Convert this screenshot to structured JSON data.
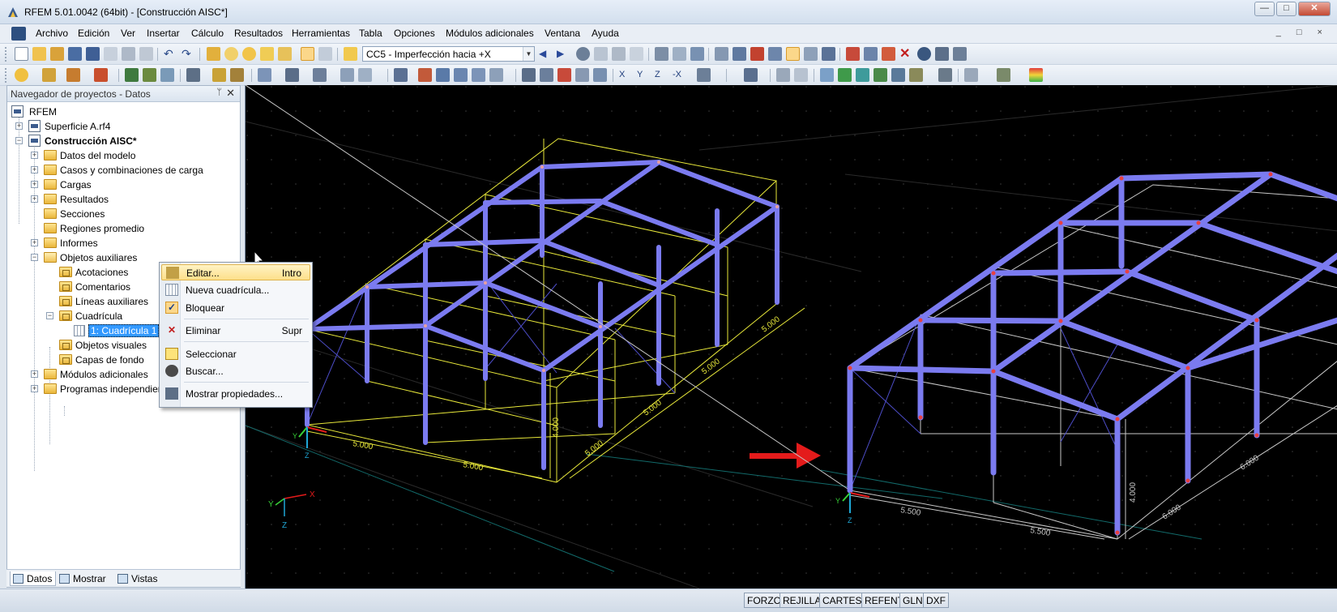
{
  "window": {
    "title": "RFEM 5.01.0042 (64bit) - [Construcción AISC*]",
    "minimize_glyph": "—",
    "maximize_glyph": "□",
    "close_glyph": "✕"
  },
  "menu": {
    "items": [
      "Archivo",
      "Edición",
      "Ver",
      "Insertar",
      "Cálculo",
      "Resultados",
      "Herramientas",
      "Tabla",
      "Opciones",
      "Módulos adicionales",
      "Ventana",
      "Ayuda"
    ],
    "mdi_controls": "_ □ ×"
  },
  "toolbar": {
    "load_case": "CC5 - Imperfección hacia +X",
    "combo_arrow": "▼"
  },
  "navigator": {
    "title": "Navegador de proyectos - Datos",
    "pin_glyph": "ᛘ",
    "close_glyph": "✕",
    "tree": {
      "root": "RFEM",
      "file1": "Superficie A.rf4",
      "file2": "Construcción AISC*",
      "datos_modelo": "Datos del modelo",
      "casos": "Casos y combinaciones de carga",
      "cargas": "Cargas",
      "resultados": "Resultados",
      "secciones": "Secciones",
      "regiones": "Regiones promedio",
      "informes": "Informes",
      "objetos_aux": "Objetos auxiliares",
      "acotaciones": "Acotaciones",
      "comentarios": "Comentarios",
      "lineas_aux": "Líneas auxiliares",
      "cuadricula": "Cuadrícula",
      "cuadricula1": "1: Cuadrícula 1",
      "objetos_visuales": "Objetos visuales",
      "capas_fondo": "Capas de fondo",
      "modulos": "Módulos adicionales",
      "programas": "Programas independientes"
    },
    "tabs": [
      "Datos",
      "Mostrar",
      "Vistas"
    ]
  },
  "context_menu": {
    "editar": "Editar...",
    "editar_shortcut": "Intro",
    "nueva": "Nueva cuadrícula...",
    "bloquear": "Bloquear",
    "bloquear_check": "✓",
    "eliminar": "Eliminar",
    "eliminar_shortcut": "Supr",
    "seleccionar": "Seleccionar",
    "buscar": "Buscar...",
    "mostrar": "Mostrar propiedades..."
  },
  "viewport": {
    "left_model": {
      "dims": [
        "5.000",
        "5.000",
        "4.000",
        "5.000",
        "5.000",
        "5.000",
        "5.000"
      ],
      "axes": {
        "x": "X",
        "y": "Y",
        "z": "Z"
      }
    },
    "right_model": {
      "dims": [
        "5.500",
        "5.500",
        "4.000",
        "6.000",
        "6.000"
      ],
      "axes": {
        "x": "X",
        "y": "Y",
        "z": "Z"
      }
    },
    "colors": {
      "background": "#000000",
      "member": "#7b7bf0",
      "grid_old": "#e8e83a",
      "grid_new": "#c8c8c8",
      "arrow": "#e41b1b"
    }
  },
  "status": {
    "toggles": [
      "FORZC",
      "REJILLA",
      "CARTES",
      "REFENT",
      "GLN",
      "DXF"
    ]
  }
}
